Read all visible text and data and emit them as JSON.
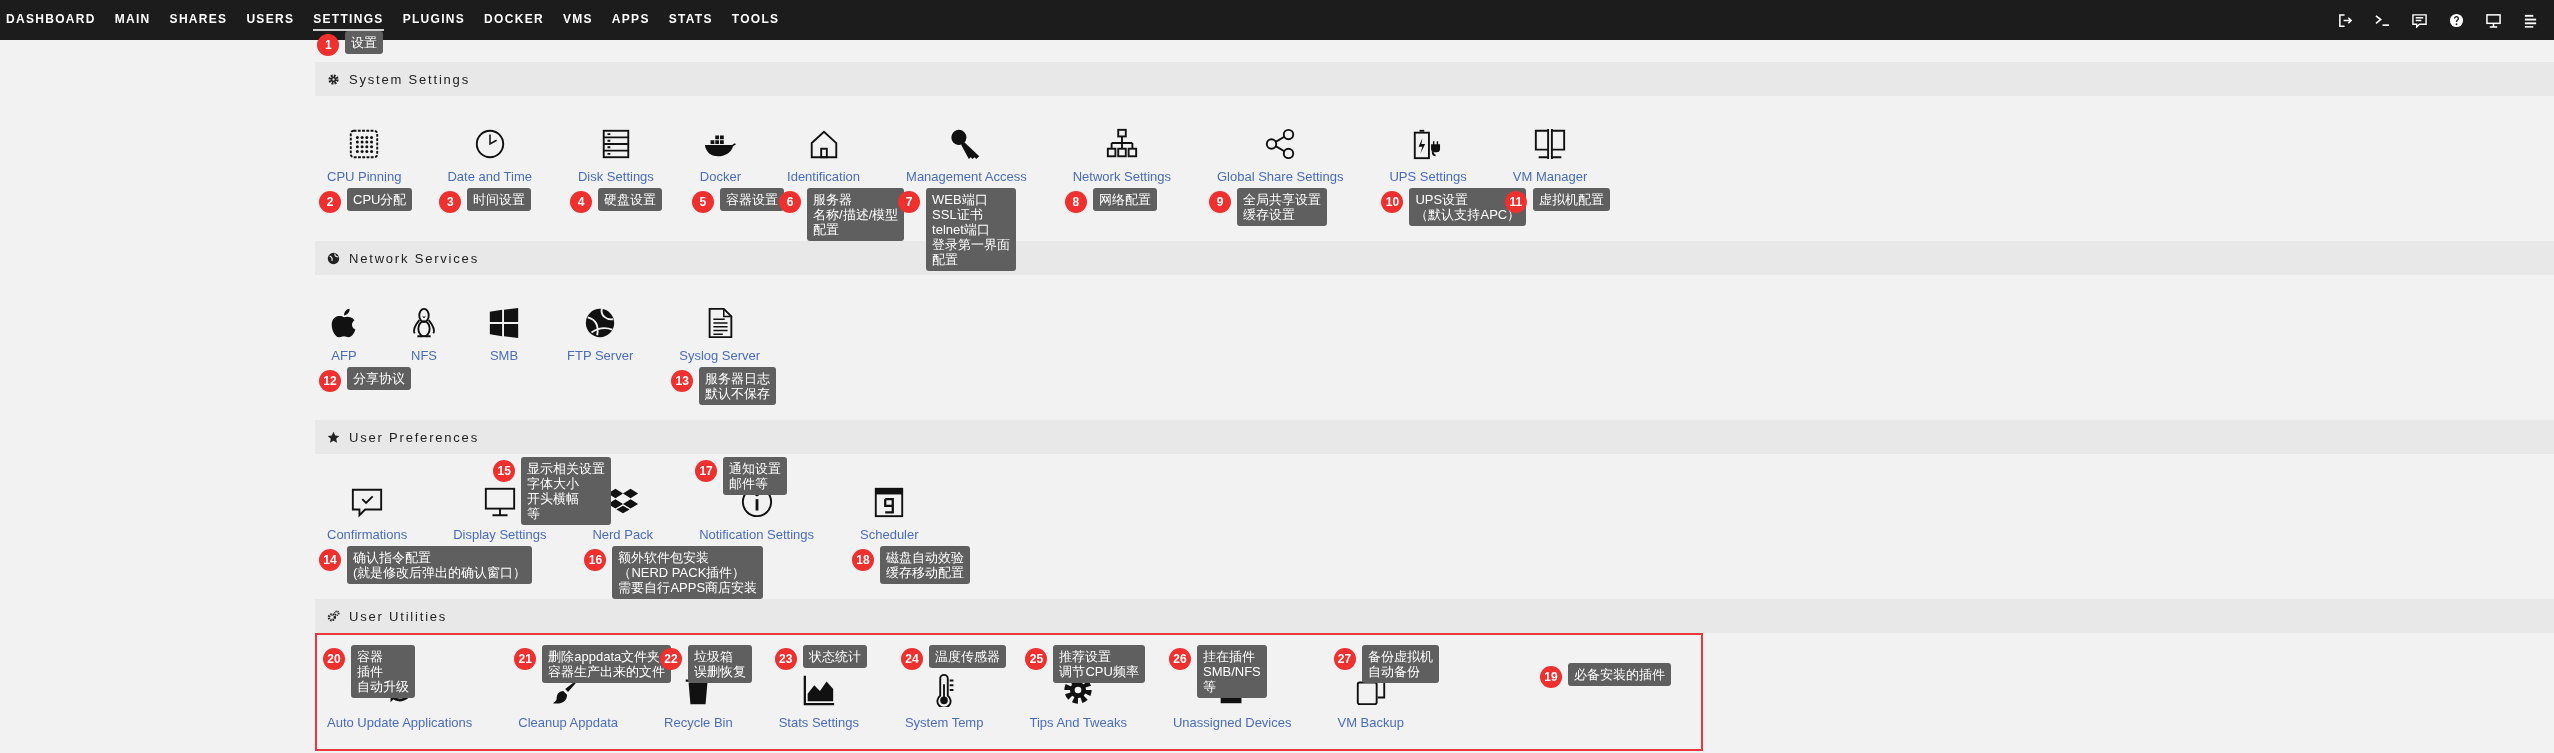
{
  "nav": {
    "items": [
      {
        "label": "DASHBOARD",
        "selected": false
      },
      {
        "label": "MAIN",
        "selected": false
      },
      {
        "label": "SHARES",
        "selected": false
      },
      {
        "label": "USERS",
        "selected": false
      },
      {
        "label": "SETTINGS",
        "selected": true,
        "note": {
          "number": "1",
          "lines": [
            "设置"
          ]
        }
      },
      {
        "label": "PLUGINS",
        "selected": false
      },
      {
        "label": "DOCKER",
        "selected": false
      },
      {
        "label": "VMS",
        "selected": false
      },
      {
        "label": "APPS",
        "selected": false
      },
      {
        "label": "STATS",
        "selected": false
      },
      {
        "label": "TOOLS",
        "selected": false
      }
    ]
  },
  "sections": [
    {
      "title": "System Settings",
      "items": [
        {
          "label": "CPU Pinning",
          "note": {
            "number": "2",
            "lines": [
              "CPU分配"
            ]
          }
        },
        {
          "label": "Date and Time",
          "note": {
            "number": "3",
            "lines": [
              "时间设置"
            ]
          }
        },
        {
          "label": "Disk Settings",
          "note": {
            "number": "4",
            "lines": [
              "硬盘设置"
            ]
          }
        },
        {
          "label": "Docker",
          "note": {
            "number": "5",
            "lines": [
              "容器设置"
            ]
          }
        },
        {
          "label": "Identification",
          "note": {
            "number": "6",
            "lines": [
              "服务器",
              "名称/描述/模型",
              "配置"
            ]
          }
        },
        {
          "label": "Management Access",
          "note": {
            "number": "7",
            "lines": [
              "WEB端口",
              "SSL证书",
              "telnet端口",
              "登录第一界面",
              "配置"
            ]
          }
        },
        {
          "label": "Network Settings",
          "note": {
            "number": "8",
            "lines": [
              "网络配置"
            ]
          }
        },
        {
          "label": "Global Share Settings",
          "note": {
            "number": "9",
            "lines": [
              "全局共享设置",
              "缓存设置"
            ]
          }
        },
        {
          "label": "UPS Settings",
          "note": {
            "number": "10",
            "lines": [
              "UPS设置",
              "（默认支持APC）"
            ]
          }
        },
        {
          "label": "VM Manager",
          "note": {
            "number": "11",
            "lines": [
              "虚拟机配置"
            ]
          }
        }
      ]
    },
    {
      "title": "Network Services",
      "items": [
        {
          "label": "AFP",
          "note": {
            "number": "12",
            "lines": [
              "分享协议"
            ]
          }
        },
        {
          "label": "NFS"
        },
        {
          "label": "SMB"
        },
        {
          "label": "FTP Server"
        },
        {
          "label": "Syslog Server",
          "note": {
            "number": "13",
            "lines": [
              "服务器日志",
              "默认不保存"
            ]
          }
        }
      ]
    },
    {
      "title": "User Preferences",
      "items": [
        {
          "label": "Confirmations",
          "note": {
            "number": "14",
            "lines": [
              "确认指令配置",
              "(就是修改后弹出的确认窗口）"
            ]
          }
        },
        {
          "label": "Display Settings",
          "note": {
            "number": "15",
            "lines": [
              "显示相关设置",
              "字体大小",
              "开头横幅",
              "等"
            ]
          }
        },
        {
          "label": "Nerd Pack",
          "note": {
            "number": "16",
            "lines": [
              "额外软件包安装",
              "（NERD PACK插件）",
              "需要自行APPS商店安装"
            ]
          }
        },
        {
          "label": "Notification Settings",
          "note": {
            "number": "17",
            "lines": [
              "通知设置",
              "邮件等"
            ]
          }
        },
        {
          "label": "Scheduler",
          "note": {
            "number": "18",
            "lines": [
              "磁盘自动效验",
              "缓存移动配置"
            ]
          }
        }
      ]
    },
    {
      "title": "User Utilities",
      "highlighted": true,
      "note": {
        "number": "19",
        "lines": [
          "必备安装的插件"
        ]
      },
      "items": [
        {
          "label": "Auto Update Applications",
          "note": {
            "number": "20",
            "lines": [
              "容器",
              "插件",
              "自动升级"
            ]
          }
        },
        {
          "label": "Cleanup Appdata",
          "note": {
            "number": "21",
            "lines": [
              "删除appdata文件夹",
              "容器生产出来的文件"
            ]
          }
        },
        {
          "label": "Recycle Bin",
          "note": {
            "number": "22",
            "lines": [
              "垃圾箱",
              "误删恢复"
            ]
          }
        },
        {
          "label": "Stats Settings",
          "note": {
            "number": "23",
            "lines": [
              "状态统计"
            ]
          }
        },
        {
          "label": "System Temp",
          "note": {
            "number": "24",
            "lines": [
              "温度传感器"
            ]
          }
        },
        {
          "label": "Tips And Tweaks",
          "note": {
            "number": "25",
            "lines": [
              "推荐设置",
              "调节CPU频率"
            ]
          }
        },
        {
          "label": "Unassigned Devices",
          "note": {
            "number": "26",
            "lines": [
              "挂在插件",
              "SMB/NFS",
              "等"
            ]
          }
        },
        {
          "label": "VM Backup",
          "note": {
            "number": "27",
            "lines": [
              "备份虚拟机",
              "自动备份"
            ]
          }
        }
      ]
    }
  ]
}
